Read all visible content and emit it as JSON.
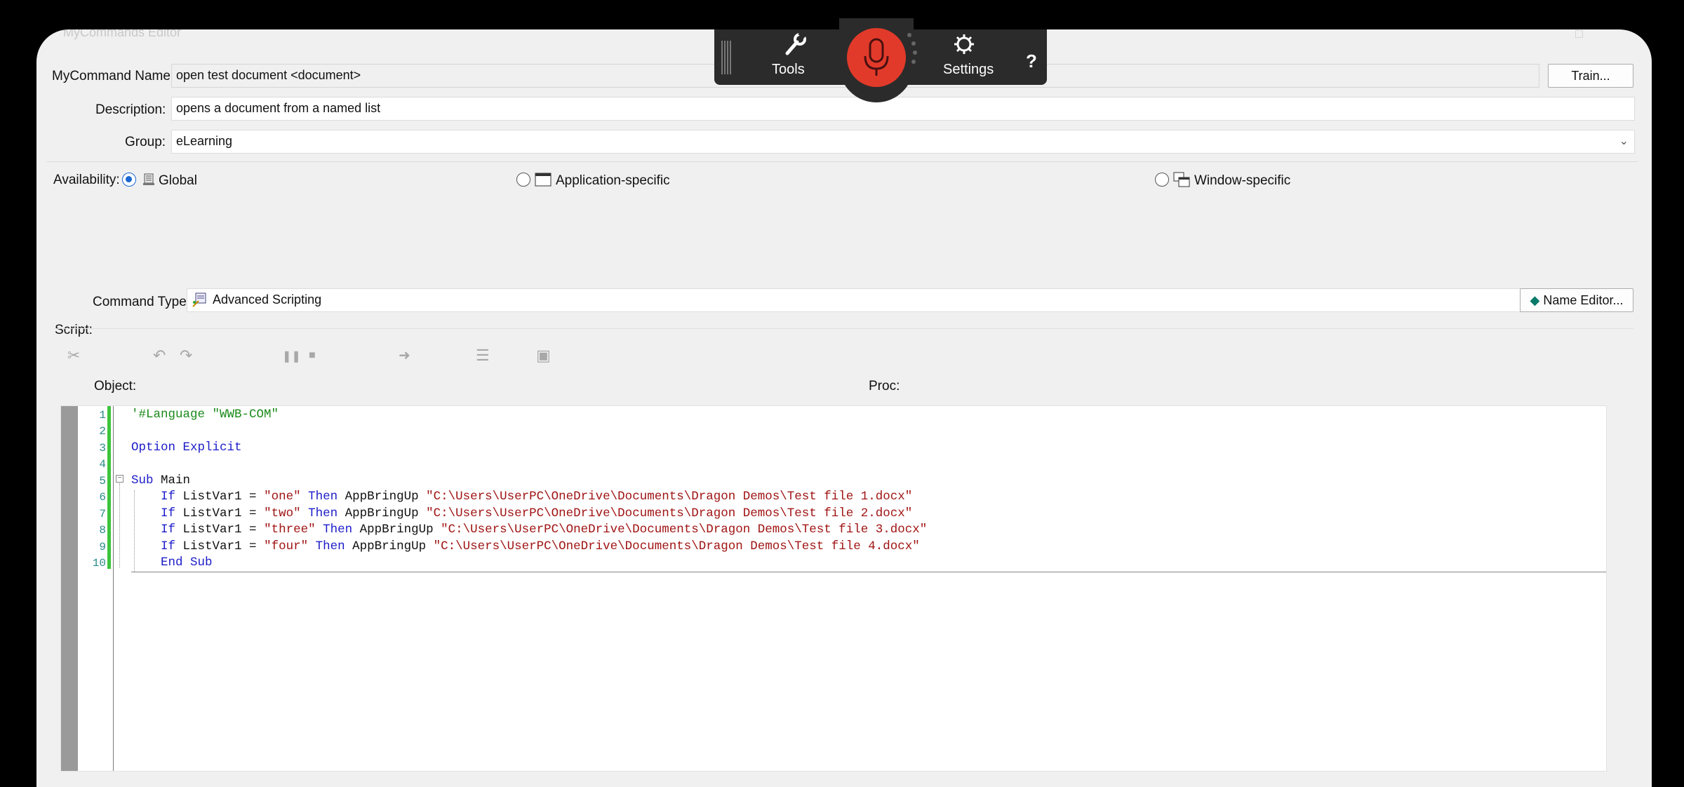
{
  "window": {
    "title": "MyCommands Editor",
    "control": "□"
  },
  "form": {
    "name_label": "MyCommand Name:",
    "name_value": "open test document <document>",
    "train_button": "Train...",
    "description_label": "Description:",
    "description_value": "opens a document from a named list",
    "group_label": "Group:",
    "group_value": "eLearning",
    "availability_label": "Availability:",
    "availability_options": [
      "Global",
      "Application-specific",
      "Window-specific"
    ],
    "availability_selected": "Global",
    "command_type_label": "Command Type:",
    "command_type_value": "Advanced Scripting",
    "name_editor_button": "Name Editor...",
    "script_label": "Script:",
    "object_label": "Object:",
    "proc_label": "Proc:"
  },
  "script": {
    "line_numbers": [
      "1",
      "2",
      "3",
      "4",
      "5",
      "6",
      "7",
      "8",
      "9",
      "10"
    ],
    "lines": [
      "'#Language \"WWB-COM\"",
      "",
      "Option Explicit",
      "",
      "Sub Main",
      "    If ListVar1 = \"one\" Then AppBringUp \"C:\\Users\\UserPC\\OneDrive\\Documents\\Dragon Demos\\Test file 1.docx\"",
      "    If ListVar1 = \"two\" Then AppBringUp \"C:\\Users\\UserPC\\OneDrive\\Documents\\Dragon Demos\\Test file 2.docx\"",
      "    If ListVar1 = \"three\" Then AppBringUp \"C:\\Users\\UserPC\\OneDrive\\Documents\\Dragon Demos\\Test file 3.docx\"",
      "    If ListVar1 = \"four\" Then AppBringUp \"C:\\Users\\UserPC\\OneDrive\\Documents\\Dragon Demos\\Test file 4.docx\"",
      "    End Sub"
    ]
  },
  "dragon_bar": {
    "tools_label": "Tools",
    "settings_label": "Settings",
    "help_label": "?"
  },
  "colors": {
    "mic": "#e23a2a",
    "keyword": "#1c1cc8",
    "string": "#a01414",
    "comment": "#1a8a1a",
    "bar": "#2b2b2b"
  },
  "icons": [
    "wrench-icon",
    "microphone-icon",
    "gear-icon",
    "help-icon",
    "cut-icon",
    "undo-icon",
    "redo-icon",
    "pause-icon",
    "stop-icon",
    "step-icon",
    "comment-icon",
    "dialog-icon"
  ]
}
